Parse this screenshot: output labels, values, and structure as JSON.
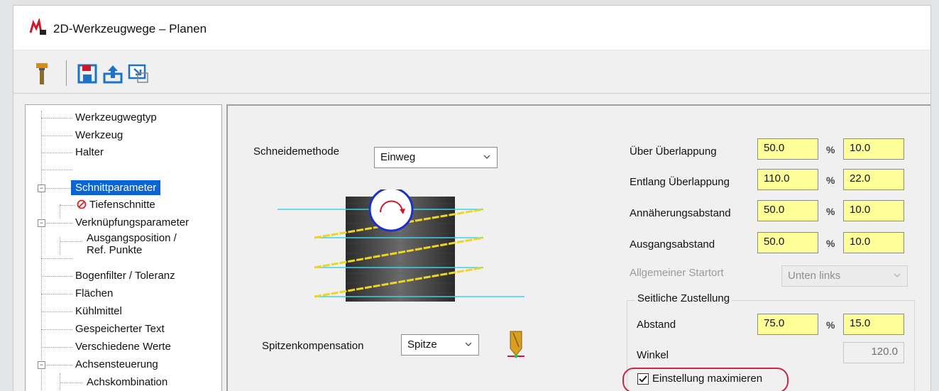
{
  "window": {
    "title": "2D-Werkzeugwege – Planen"
  },
  "colors": {
    "accent": "#0a64d6",
    "field_yellow": "#ffff9a",
    "highlight": "#c8264a"
  },
  "toolbar": {
    "icons": [
      "tool-holder-icon",
      "save-icon",
      "export-icon",
      "import-icon"
    ]
  },
  "tree": {
    "items": [
      {
        "label": "Werkzeugwegtyp"
      },
      {
        "label": "Werkzeug"
      },
      {
        "label": "Halter"
      },
      {
        "label": ""
      },
      {
        "label": "Schnittparameter",
        "selected": true,
        "expander": "−"
      },
      {
        "label": "Tiefenschnitte",
        "icon": "prohibited-icon"
      },
      {
        "label": "Verknüpfungsparameter",
        "expander": "−"
      },
      {
        "label": "Ausgangsposition /"
      },
      {
        "label": "Ref. Punkte"
      },
      {
        "label": "Bogenfilter / Toleranz"
      },
      {
        "label": "Flächen"
      },
      {
        "label": "Kühlmittel"
      },
      {
        "label": "Gespeicherter Text"
      },
      {
        "label": "Verschiedene Werte"
      },
      {
        "label": "Achsensteuerung",
        "expander": "−"
      },
      {
        "label": "Achskombination"
      }
    ]
  },
  "params": {
    "schneidemethode": {
      "label": "Schneidemethode",
      "value": "Einweg"
    },
    "spitzenkompensation": {
      "label": "Spitzenkompensation",
      "value": "Spitze"
    },
    "ueber_ueberlappung": {
      "label": "Über Überlappung",
      "value": "50.0",
      "value2": "10.0"
    },
    "entlang_ueberlappung": {
      "label": "Entlang Überlappung",
      "value": "110.0",
      "value2": "22.0"
    },
    "annaeherungsabstand": {
      "label": "Annäherungsabstand",
      "value": "50.0",
      "value2": "10.0"
    },
    "ausgangsabstand": {
      "label": "Ausgangsabstand",
      "value": "50.0",
      "value2": "10.0"
    },
    "startort": {
      "label": "Allgemeiner Startort",
      "value": "Unten links"
    },
    "percent_symbol": "%",
    "seitliche": {
      "title": "Seitliche Zustellung",
      "abstand_label": "Abstand",
      "abstand_value": "75.0",
      "abstand_value2": "15.0",
      "winkel_label": "Winkel",
      "winkel_value": "120.0",
      "maximize_label": "Einstellung maximieren",
      "maximize_checked": true
    }
  }
}
